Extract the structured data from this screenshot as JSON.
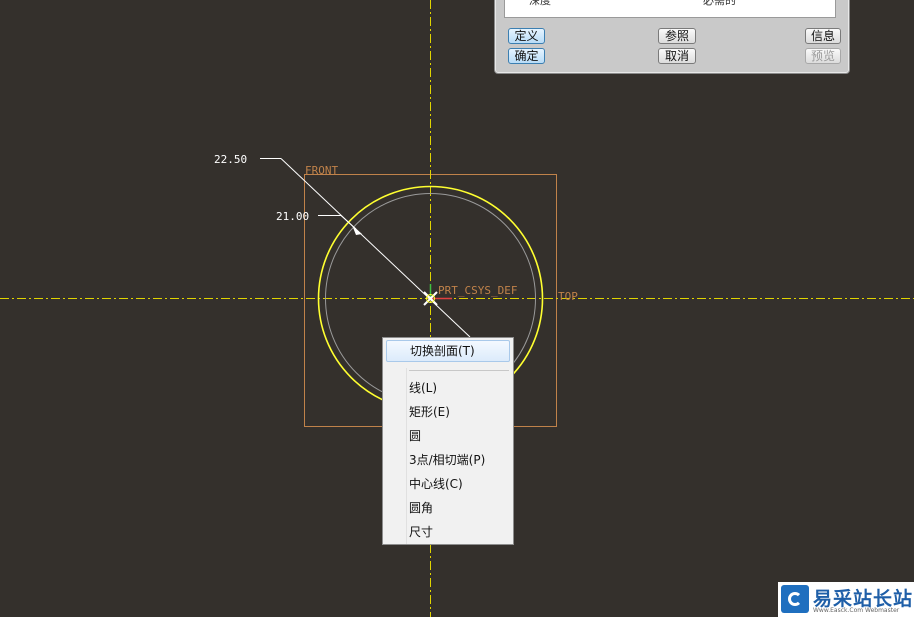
{
  "dialog": {
    "row": {
      "col1": "深度",
      "col2": "必需的"
    },
    "buttons": {
      "define": "定义",
      "references": "参照",
      "info": "信息",
      "ok": "确定",
      "cancel": "取消",
      "preview": "预览"
    }
  },
  "sketch": {
    "dim_outer": "22.50",
    "dim_inner": "21.00",
    "plane_front": "FRONT",
    "plane_top": "TOP",
    "csys": "PRT_CSYS_DEF"
  },
  "context_menu": {
    "items": [
      "切换剖面(T)",
      "线(L)",
      "矩形(E)",
      "圆",
      "3点/相切端(P)",
      "中心线(C)",
      "圆角",
      "尺寸"
    ]
  },
  "watermark": {
    "name": "易采站长站",
    "sub": "Www.Easck.Com Webmaster"
  },
  "colors": {
    "background": "#34302c",
    "axis": "#e0d400",
    "plane": "#c0824a",
    "circle_outer": "#ffff30",
    "circle_inner": "#9a9a9a",
    "dimension": "#ffffff"
  }
}
